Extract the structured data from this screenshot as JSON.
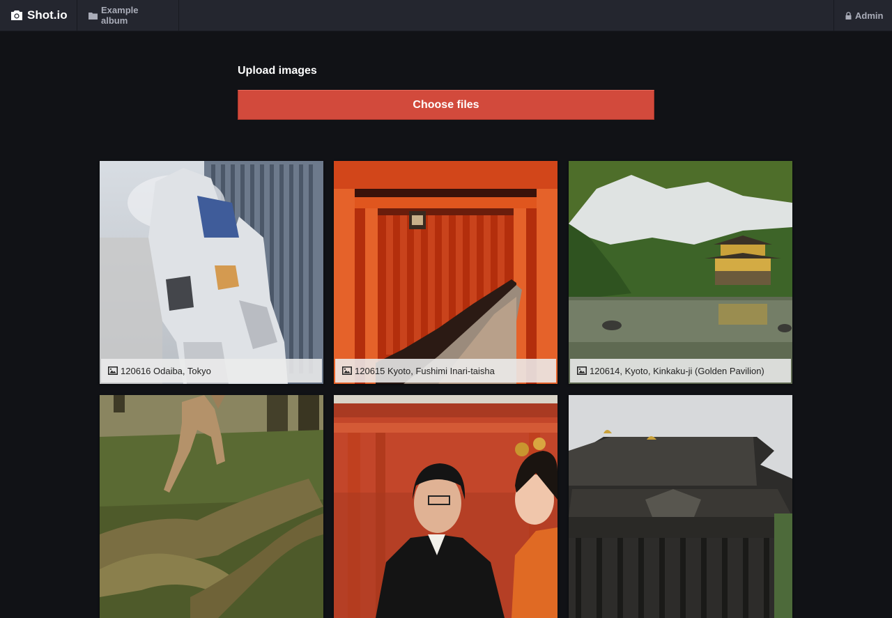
{
  "nav": {
    "brand": "Shot.io",
    "album": "Example album",
    "admin": "Admin"
  },
  "upload": {
    "title": "Upload images",
    "button": "Choose files"
  },
  "gallery": {
    "items": [
      {
        "caption": "120616 Odaiba, Tokyo"
      },
      {
        "caption": "120615 Kyoto, Fushimi Inari-taisha"
      },
      {
        "caption": "120614, Kyoto, Kinkaku-ji (Golden Pavilion)"
      },
      {
        "caption": ""
      },
      {
        "caption": ""
      },
      {
        "caption": ""
      }
    ]
  },
  "icons": {
    "brand": "camera-icon",
    "album": "folder-icon",
    "admin": "lock-icon",
    "caption": "image-icon"
  },
  "colors": {
    "background": "#111216",
    "topbar": "#24262f",
    "accent_button": "#d24a3c"
  }
}
